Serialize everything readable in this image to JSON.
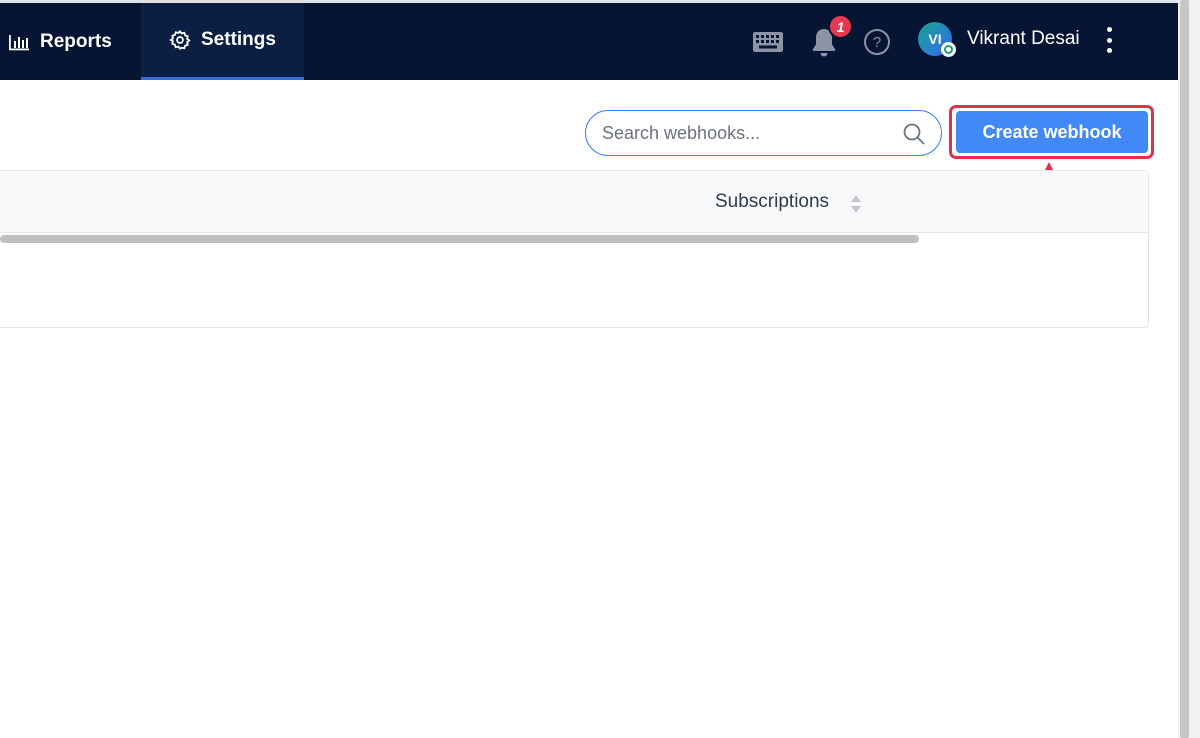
{
  "nav": {
    "tabs": [
      {
        "label": "Reports",
        "icon": "bar-chart-icon"
      },
      {
        "label": "Settings",
        "icon": "gear-icon",
        "active": true
      }
    ],
    "notification_count": "1",
    "help_label": "?",
    "user": {
      "initials": "VI",
      "name": "Vikrant Desai"
    }
  },
  "toolbar": {
    "search_placeholder": "Search webhooks...",
    "create_label": "Create webhook"
  },
  "table": {
    "columns": [
      "Subscriptions"
    ]
  },
  "colors": {
    "nav_bg": "#061533",
    "primary": "#4089f7",
    "highlight": "#e0304e",
    "badge": "#e8384f"
  }
}
